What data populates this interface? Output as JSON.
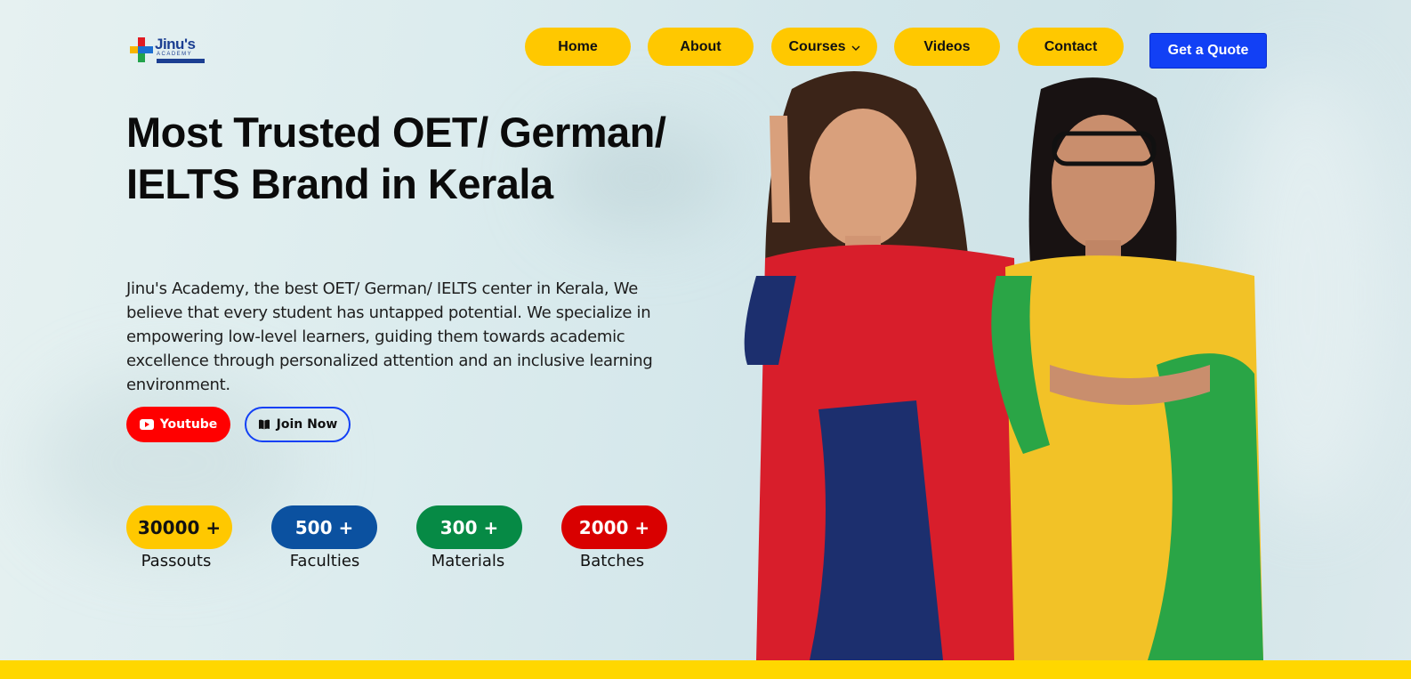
{
  "brand": {
    "logo_text": "Jinu's",
    "logo_sub": "ACADEMY"
  },
  "nav": {
    "items": [
      "Home",
      "About",
      "Courses",
      "Videos",
      "Contact"
    ],
    "courses_chevron": "⌵",
    "cta": "Get a Quote"
  },
  "hero": {
    "headline": "Most Trusted OET/ German/ IELTS Brand in Kerala",
    "description": "Jinu's Academy, the best OET/ German/ IELTS center in Kerala, We believe that every student has untapped potential. We specialize in empowering low-level learners, guiding them towards academic excellence through personalized attention and an inclusive learning environment.",
    "youtube_label": "Youtube",
    "join_label": "Join Now"
  },
  "stats": [
    {
      "value": "30000 +",
      "label": "Passouts",
      "color": "#ffc800",
      "text_color": "#111111"
    },
    {
      "value": "500 +",
      "label": "Faculties",
      "color": "#0b51a0",
      "text_color": "#ffffff"
    },
    {
      "value": "300 +",
      "label": "Materials",
      "color": "#068a45",
      "text_color": "#ffffff"
    },
    {
      "value": "2000 +",
      "label": "Batches",
      "color": "#d90000",
      "text_color": "#ffffff"
    }
  ],
  "colors": {
    "accent_yellow": "#ffc800",
    "primary_blue": "#1240f5",
    "youtube_red": "#ff0000"
  }
}
